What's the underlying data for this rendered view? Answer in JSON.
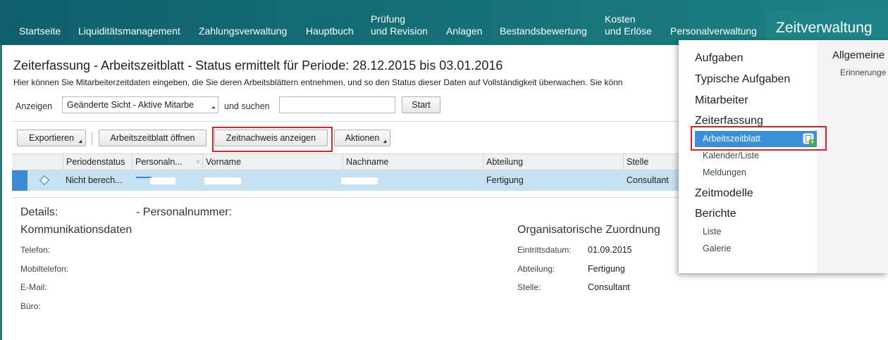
{
  "topnav": {
    "items": [
      {
        "label": "Startseite"
      },
      {
        "label": "Liquiditätsmanagement"
      },
      {
        "label": "Zahlungsverwaltung"
      },
      {
        "label": "Hauptbuch"
      },
      {
        "label_line1": "Prüfung",
        "label_line2": "und Revision"
      },
      {
        "label": "Anlagen"
      },
      {
        "label": "Bestandsbewertung"
      },
      {
        "label_line1": "Kosten",
        "label_line2": "und Erlöse"
      },
      {
        "label": "Personalverwaltung"
      }
    ],
    "active": "Zeitverwaltung"
  },
  "page": {
    "title": "Zeiterfassung - Arbeitszeitblatt - Status ermittelt für Periode: 28.12.2015 bis 03.01.2016",
    "description": "Hier können Sie Mitarbeiterzeitdaten eingeben, die Sie deren Arbeitsblättern entnehmen, und so den Status dieser Daten auf Vollständigkeit überwachen. Sie könn"
  },
  "filter": {
    "show_label": "Anzeigen",
    "view_value": "Geänderte Sicht - Aktive Mitarbe",
    "search_label": "und suchen",
    "search_value": "",
    "start_button": "Start"
  },
  "toolbar": {
    "export": "Exportieren",
    "open_timesheet": "Arbeitszeitblatt öffnen",
    "show_time_record": "Zeitnachweis anzeigen",
    "actions": "Aktionen"
  },
  "table": {
    "columns": [
      "Periodenstatus",
      "Personaln...",
      "Vorname",
      "Nachname",
      "Abteilung",
      "Stelle"
    ],
    "rows": [
      {
        "status": "Nicht berech...",
        "department": "Fertigung",
        "position": "Consultant"
      }
    ]
  },
  "details": {
    "title": "Details:",
    "personnel_label": "- Personalnummer:",
    "communication": {
      "heading": "Kommunikationsdaten",
      "fields": [
        "Telefon:",
        "Mobiltelefon:",
        "E-Mail:",
        "Büro:"
      ]
    },
    "organisation": {
      "heading": "Organisatorische Zuordnung",
      "entry_date_label": "Eintrittsdatum:",
      "entry_date_value": "01.09.2015",
      "department_label": "Abteilung:",
      "department_value": "Fertigung",
      "position_label": "Stelle:",
      "position_value": "Consultant"
    }
  },
  "menu": {
    "groups": [
      {
        "label": "Aufgaben"
      },
      {
        "label": "Typische Aufgaben"
      },
      {
        "label": "Mitarbeiter"
      },
      {
        "label": "Zeiterfassung",
        "children": [
          "Arbeitszeitblatt",
          "Kalender/Liste",
          "Meldungen"
        ]
      },
      {
        "label": "Zeitmodelle"
      },
      {
        "label": "Berichte",
        "children": [
          "Liste",
          "Galerie"
        ]
      }
    ],
    "right_heading": "Allgemeine",
    "right_item": "Erinnerunge"
  },
  "colors": {
    "nav_bg": "#136e75",
    "nav_active": "#1d8386",
    "row_selected": "#c6e1f1",
    "menu_active": "#3a8fd9",
    "highlight": "#d9262a"
  }
}
